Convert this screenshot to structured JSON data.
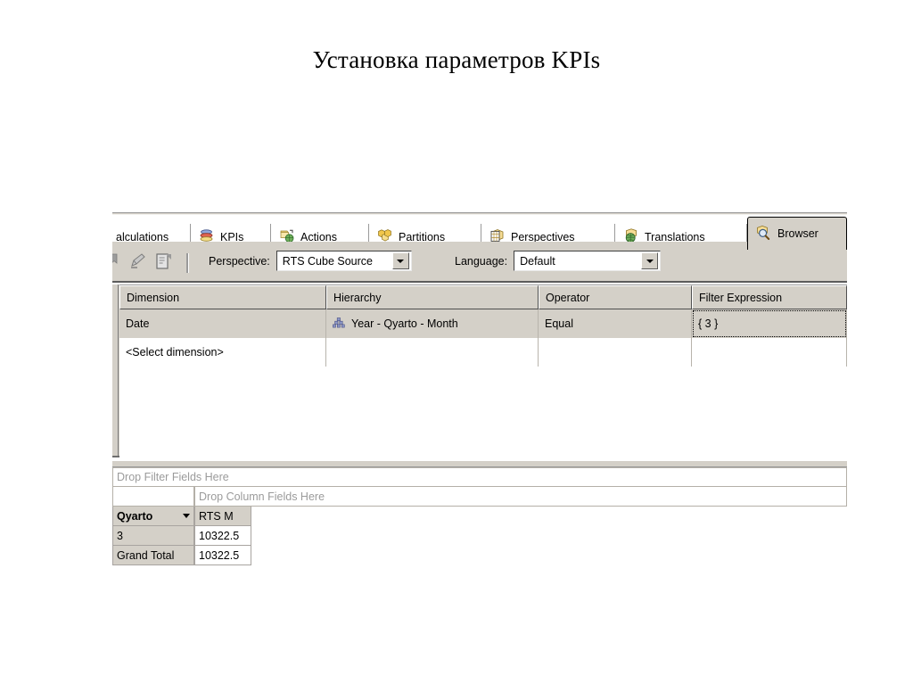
{
  "slide": {
    "title": "Установка параметров KPIs"
  },
  "tabs": [
    {
      "label": "alculations",
      "icon": "none",
      "active": false
    },
    {
      "label": "KPIs",
      "icon": "kpi-stack-icon",
      "active": false
    },
    {
      "label": "Actions",
      "icon": "actions-globe-icon",
      "active": false
    },
    {
      "label": "Partitions",
      "icon": "partitions-cubes-icon",
      "active": false
    },
    {
      "label": "Perspectives",
      "icon": "perspectives-cube-icon",
      "active": false
    },
    {
      "label": "Translations",
      "icon": "translations-globe-icon",
      "active": false
    },
    {
      "label": "Browser",
      "icon": "browser-magnifier-icon",
      "active": true
    }
  ],
  "toolbar": {
    "icons": [
      "clip-icon",
      "pencil-edit-icon",
      "document-icon"
    ],
    "perspective": {
      "label": "Perspective:",
      "value": "RTS Cube Source"
    },
    "language": {
      "label": "Language:",
      "value": "Default"
    }
  },
  "filter_grid": {
    "columns": [
      "Dimension",
      "Hierarchy",
      "Operator",
      "Filter Expression"
    ],
    "rows": [
      {
        "dimension": "Date",
        "hierarchy": "Year -  Qyarto -  Month",
        "hierarchy_icon": "hierarchy-pyramid-icon",
        "operator": "Equal",
        "filter_expression": "{ 3 }",
        "selected": true,
        "focused_cell": "filter_expression"
      },
      {
        "dimension": "<Select dimension>",
        "hierarchy": "",
        "hierarchy_icon": "none",
        "operator": "",
        "filter_expression": "",
        "selected": false,
        "focused_cell": ""
      }
    ]
  },
  "pivot": {
    "drop_filter_text": "Drop Filter Fields Here",
    "drop_column_text": "Drop Column Fields Here",
    "row_field": "Qyarto",
    "measure_header": "RTS M",
    "rows": [
      {
        "label": "3",
        "value": "10322.5"
      },
      {
        "label": "Grand Total",
        "value": "10322.5"
      }
    ]
  },
  "colors": {
    "chrome": "#d4d0c8",
    "grid_line": "#b8b4ac",
    "placeholder_text": "#9b9b9b",
    "accent_yellow": "#f0c419",
    "accent_blue": "#5a6fb4"
  }
}
